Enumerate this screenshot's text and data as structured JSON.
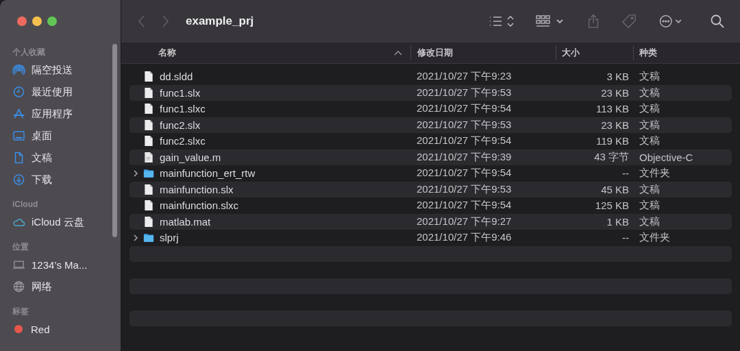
{
  "window": {
    "title": "example_prj"
  },
  "sidebar": {
    "sections": [
      {
        "title": "个人收藏",
        "items": [
          {
            "label": "隔空投送",
            "kind": "airdrop"
          },
          {
            "label": "最近使用",
            "kind": "recents"
          },
          {
            "label": "应用程序",
            "kind": "apps"
          },
          {
            "label": "桌面",
            "kind": "desktop"
          },
          {
            "label": "文稿",
            "kind": "documents"
          },
          {
            "label": "下载",
            "kind": "downloads"
          }
        ]
      },
      {
        "title": "iCloud",
        "items": [
          {
            "label": "iCloud 云盘",
            "kind": "cloud"
          }
        ]
      },
      {
        "title": "位置",
        "items": [
          {
            "label": "1234’s Ma...",
            "kind": "computer"
          },
          {
            "label": "网络",
            "kind": "network"
          }
        ]
      },
      {
        "title": "标签",
        "items": [
          {
            "label": "Red",
            "kind": "tag",
            "color": "#e8574b"
          }
        ]
      }
    ]
  },
  "table": {
    "columns": [
      {
        "label": "名称",
        "sorted": true
      },
      {
        "label": "修改日期",
        "sorted": false
      },
      {
        "label": "大小",
        "sorted": false
      },
      {
        "label": "种类",
        "sorted": false
      }
    ],
    "rows": [
      {
        "name": "dd.sldd",
        "kind": "file",
        "date": "2021/10/27 下午9:23",
        "size": "3 KB",
        "type": "文稿"
      },
      {
        "name": "func1.slx",
        "kind": "file",
        "date": "2021/10/27 下午9:53",
        "size": "23 KB",
        "type": "文稿"
      },
      {
        "name": "func1.slxc",
        "kind": "file",
        "date": "2021/10/27 下午9:54",
        "size": "113 KB",
        "type": "文稿"
      },
      {
        "name": "func2.slx",
        "kind": "file",
        "date": "2021/10/27 下午9:53",
        "size": "23 KB",
        "type": "文稿"
      },
      {
        "name": "func2.slxc",
        "kind": "file",
        "date": "2021/10/27 下午9:54",
        "size": "119 KB",
        "type": "文稿"
      },
      {
        "name": "gain_value.m",
        "kind": "text",
        "date": "2021/10/27 下午9:39",
        "size": "43 字节",
        "type": "Objective-C"
      },
      {
        "name": "mainfunction_ert_rtw",
        "kind": "folder",
        "expanded": false,
        "date": "2021/10/27 下午9:54",
        "size": "--",
        "type": "文件夹"
      },
      {
        "name": "mainfunction.slx",
        "kind": "file",
        "date": "2021/10/27 下午9:53",
        "size": "45 KB",
        "type": "文稿"
      },
      {
        "name": "mainfunction.slxc",
        "kind": "file",
        "date": "2021/10/27 下午9:54",
        "size": "125 KB",
        "type": "文稿"
      },
      {
        "name": "matlab.mat",
        "kind": "file",
        "date": "2021/10/27 下午9:27",
        "size": "1 KB",
        "type": "文稿"
      },
      {
        "name": "slprj",
        "kind": "folder",
        "expanded": false,
        "date": "2021/10/27 下午9:46",
        "size": "--",
        "type": "文件夹"
      }
    ]
  }
}
